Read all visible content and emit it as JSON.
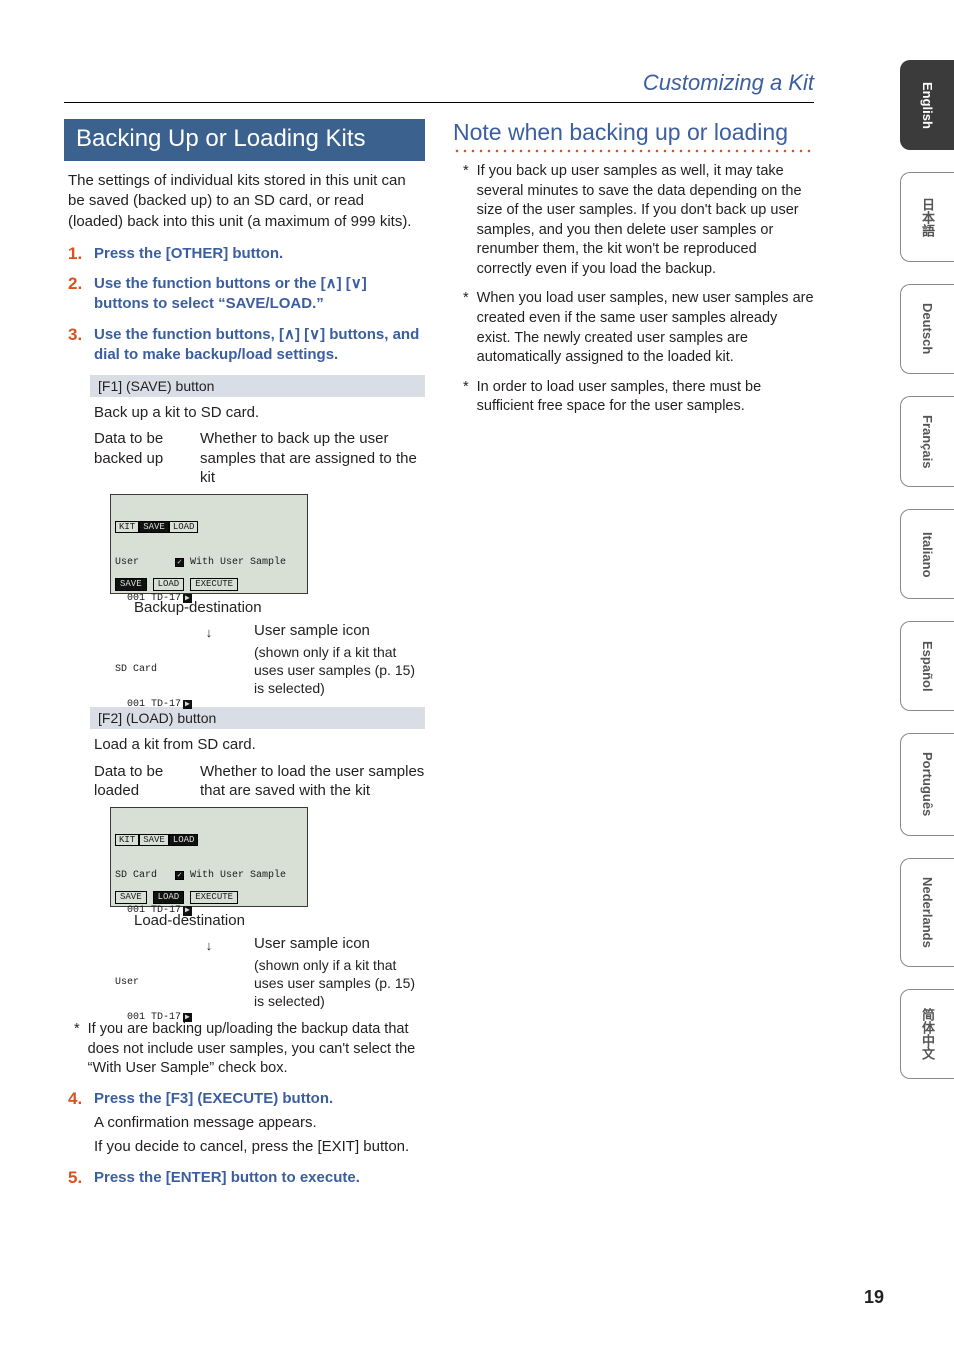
{
  "header": {
    "title": "Customizing a Kit"
  },
  "page_number": "19",
  "left": {
    "block_title": "Backing Up or Loading Kits",
    "intro": "The settings of individual kits stored in this unit can be saved (backed up) to an SD card, or read (loaded) back into this unit (a maximum of 999 kits).",
    "step1": "Press the [OTHER] button.",
    "step2": "Use the function buttons or the [∧] [∨] buttons to select “SAVE/LOAD.”",
    "step3": "Use the function buttons, [∧] [∨] buttons, and dial to make backup/load settings.",
    "f1": {
      "label": "[F1] (SAVE) button",
      "desc": "Back up a kit to SD card.",
      "anno_left": "Data to be backed up",
      "anno_right": "Whether to back up the user samples that are assigned to the kit",
      "lcd": {
        "tabs": [
          "KIT",
          "SAVE",
          "LOAD"
        ],
        "active_tab": 1,
        "lines_top_label": "User",
        "with_sample": "With User Sample",
        "row1": "  001 TD-17",
        "mid_label": "SD Card",
        "row2": "  001 TD-17",
        "fbuttons": [
          "SAVE",
          "LOAD",
          "EXECUTE"
        ]
      },
      "cap1": "Backup-destination",
      "cap2": "User sample icon",
      "cap3": "(shown only if a kit that uses user samples (p. 15) is selected)"
    },
    "f2": {
      "label": "[F2] (LOAD) button",
      "desc": "Load a kit from SD card.",
      "anno_left": "Data to be loaded",
      "anno_right": "Whether to load the user samples that are saved with the kit",
      "lcd": {
        "tabs": [
          "KIT",
          "SAVE",
          "LOAD"
        ],
        "active_tab": 2,
        "lines_top_label": "SD Card",
        "with_sample": "With User Sample",
        "row1": "  001 TD-17",
        "mid_label": "User",
        "row2": "  001 TD-17",
        "fbuttons": [
          "SAVE",
          "LOAD",
          "EXECUTE"
        ]
      },
      "cap1": "Load-destination",
      "cap2": "User sample icon",
      "cap3": "(shown only if a kit that uses user samples (p. 15) is selected)"
    },
    "footnote1": "If you are backing up/loading the backup data that does not include user samples, you can't select the “With User Sample” check box.",
    "step4_head": "Press the [F3] (EXECUTE) button.",
    "step4_body1": "A confirmation message appears.",
    "step4_body2": "If you decide to cancel, press the [EXIT] button.",
    "step5": "Press the [ENTER] button to execute."
  },
  "right": {
    "title": "Note when backing up or loading",
    "n1": "If you back up user samples as well, it may take several minutes to save the data depending on the size of the user samples. If you don't back up user samples, and you then delete user samples or renumber them, the kit won't be reproduced correctly even if you load the backup.",
    "n2": "When you load user samples, new user samples are created even if the same user samples already exist. The newly created user samples are automatically assigned to the loaded kit.",
    "n3": "In order to load user samples, there must be sufficient free space for the user samples."
  },
  "tabs": {
    "items": [
      "English",
      "日本語",
      "Deutsch",
      "Français",
      "Italiano",
      "Español",
      "Português",
      "Nederlands",
      "简体中文"
    ],
    "active": 0
  }
}
